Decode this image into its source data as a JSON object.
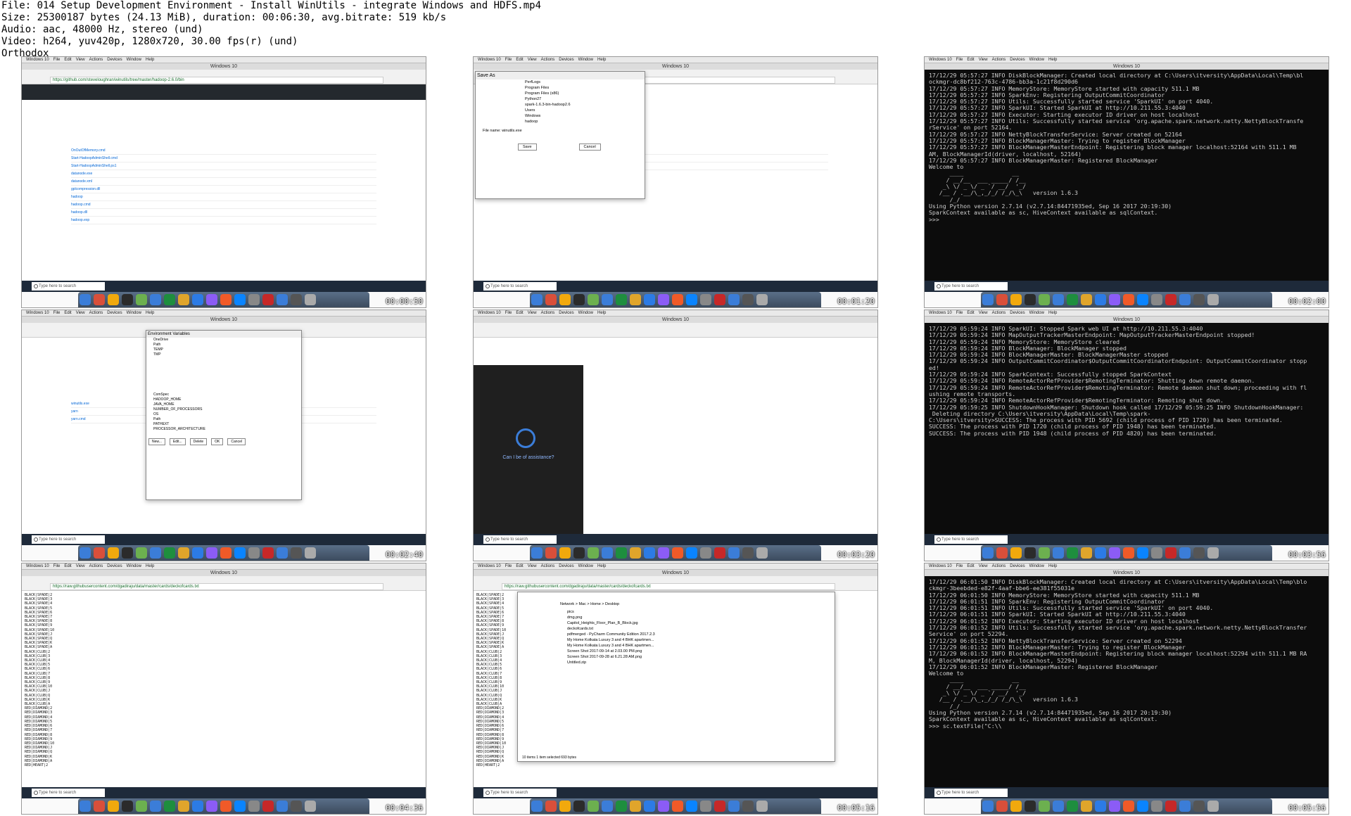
{
  "file_info": [
    "File: 014 Setup Development Environment - Install WinUtils - integrate Windows and HDFS.mp4",
    "Size: 25300187 bytes (24.13 MiB), duration: 00:06:30, avg.bitrate: 519 kb/s",
    "Audio: aac, 48000 Hz, stereo (und)",
    "Video: h264, yuv420p, 1280x720, 30.00 fps(r) (und)",
    "Orthodox"
  ],
  "vm_window_title": "Windows 10",
  "mac_menu": [
    "Windows 10",
    "File",
    "Edit",
    "View",
    "Actions",
    "Devices",
    "Window",
    "Help"
  ],
  "taskbar_search": "Type here to search",
  "thumbnails": [
    {
      "timestamp": "00:00:50",
      "kind": "github",
      "url": "https://github.com/steveloughran/winutils/tree/master/hadoop-2.6.0/bin",
      "files": [
        "OnOutOfMemory.cmd",
        "Start-HadoopAdminShell.cmd",
        "Start-HadoopAdminShell.ps1",
        "datanode.exe",
        "datanode.xml",
        "gplcompression.dll",
        "hadoop",
        "hadoop.cmd",
        "hadoop.dll",
        "hadoop.exp"
      ]
    },
    {
      "timestamp": "00:01:20",
      "kind": "saveas",
      "url": "https://github.com/steveloughran/winutils/tree/master/hadoop-2.6.0/bin",
      "dialog_title": "Save As",
      "folders": [
        "PerfLogs",
        "Program Files",
        "Program Files (x86)",
        "Python27",
        "spark-1.6.3-bin-hadoop2.6",
        "Users",
        "Windows",
        "hadoop"
      ],
      "file_name": "winutils.exe",
      "buttons": [
        "Save",
        "Cancel"
      ]
    },
    {
      "timestamp": "00:02:00",
      "kind": "terminal",
      "lines": [
        "17/12/29 05:57:27 INFO DiskBlockManager: Created local directory at C:\\Users\\itversity\\AppData\\Local\\Temp\\bl",
        "ockmgr-dc8bf212-763c-4786-bb3a-1c21f8d290d6",
        "17/12/29 05:57:27 INFO MemoryStore: MemoryStore started with capacity 511.1 MB",
        "17/12/29 05:57:27 INFO SparkEnv: Registering OutputCommitCoordinator",
        "17/12/29 05:57:27 INFO Utils: Successfully started service 'SparkUI' on port 4040.",
        "17/12/29 05:57:27 INFO SparkUI: Started SparkUI at http://10.211.55.3:4040",
        "17/12/29 05:57:27 INFO Executor: Starting executor ID driver on host localhost",
        "17/12/29 05:57:27 INFO Utils: Successfully started service 'org.apache.spark.network.netty.NettyBlockTransfe",
        "rService' on port 52164.",
        "17/12/29 05:57:27 INFO NettyBlockTransferService: Server created on 52164",
        "17/12/29 05:57:27 INFO BlockManagerMaster: Trying to register BlockManager",
        "17/12/29 05:57:27 INFO BlockManagerMasterEndpoint: Registering block manager localhost:52164 with 511.1 MB",
        "AM, BlockManagerId(driver, localhost, 52164)",
        "17/12/29 05:57:27 INFO BlockManagerMaster: Registered BlockManager",
        "Welcome to",
        "      ____              __",
        "     / __/__  ___ _____/ /__",
        "    _\\ \\/ _ \\/ _ `/ __/  '_/",
        "   /__ / .__/\\_,_/_/ /_/\\_\\   version 1.6.3",
        "      /_/",
        "",
        "Using Python version 2.7.14 (v2.7.14:84471935ed, Sep 16 2017 20:19:30)",
        "SparkContext available as sc, HiveContext available as sqlContext.",
        ">>>"
      ]
    },
    {
      "timestamp": "00:02:40",
      "kind": "envvars",
      "dialog_title": "Environment Variables",
      "user_vars": [
        "OneDrive",
        "Path",
        "TEMP",
        "TMP"
      ],
      "system_vars": [
        "ComSpec",
        "HADOOP_HOME",
        "JAVA_HOME",
        "NUMBER_OF_PROCESSORS",
        "OS",
        "Path",
        "PATHEXT",
        "PROCESSOR_ARCHITECTURE"
      ],
      "buttons": [
        "New...",
        "Edit...",
        "Delete",
        "OK",
        "Cancel"
      ]
    },
    {
      "timestamp": "00:03:20",
      "kind": "cortana",
      "prompt": "Can I be of assistance?"
    },
    {
      "timestamp": "00:03:56",
      "kind": "terminal",
      "lines": [
        "17/12/29 05:59:24 INFO SparkUI: Stopped Spark web UI at http://10.211.55.3:4040",
        "17/12/29 05:59:24 INFO MapOutputTrackerMasterEndpoint: MapOutputTrackerMasterEndpoint stopped!",
        "17/12/29 05:59:24 INFO MemoryStore: MemoryStore cleared",
        "17/12/29 05:59:24 INFO BlockManager: BlockManager stopped",
        "17/12/29 05:59:24 INFO BlockManagerMaster: BlockManagerMaster stopped",
        "17/12/29 05:59:24 INFO OutputCommitCoordinator$OutputCommitCoordinatorEndpoint: OutputCommitCoordinator stopp",
        "ed!",
        "17/12/29 05:59:24 INFO SparkContext: Successfully stopped SparkContext",
        "17/12/29 05:59:24 INFO RemoteActorRefProvider$RemotingTerminator: Shutting down remote daemon.",
        "17/12/29 05:59:24 INFO RemoteActorRefProvider$RemotingTerminator: Remote daemon shut down; proceeding with fl",
        "ushing remote transports.",
        "17/12/29 05:59:24 INFO RemoteActorRefProvider$RemotingTerminator: Remoting shut down.",
        "17/12/29 05:59:25 INFO ShutdownHookManager: Shutdown hook called 17/12/29 05:59:25 INFO ShutdownHookManager:",
        " Deleting directory C:\\Users\\itversity\\AppData\\Local\\Temp\\spark-",
        "",
        "C:\\Users\\itversity>SUCCESS: The process with PID 5692 (child process of PID 1720) has been terminated.",
        "SUCCESS: The process with PID 1720 (child process of PID 1948) has been terminated.",
        "SUCCESS: The process with PID 1948 (child process of PID 4820) has been terminated."
      ]
    },
    {
      "timestamp": "00:04:36",
      "kind": "plaintext",
      "url": "https://raw.githubusercontent.com/dgadiraju/data/master/cards/deckofcards.txt",
      "lines": [
        "BLACK|SPADE|2",
        "BLACK|SPADE|3",
        "BLACK|SPADE|4",
        "BLACK|SPADE|5",
        "BLACK|SPADE|6",
        "BLACK|SPADE|7",
        "BLACK|SPADE|8",
        "BLACK|SPADE|9",
        "BLACK|SPADE|10",
        "BLACK|SPADE|J",
        "BLACK|SPADE|Q",
        "BLACK|SPADE|K",
        "BLACK|SPADE|A",
        "BLACK|CLUB|2",
        "BLACK|CLUB|3",
        "BLACK|CLUB|4",
        "BLACK|CLUB|5",
        "BLACK|CLUB|6",
        "BLACK|CLUB|7",
        "BLACK|CLUB|8",
        "BLACK|CLUB|9",
        "BLACK|CLUB|10",
        "BLACK|CLUB|J",
        "BLACK|CLUB|Q",
        "BLACK|CLUB|K",
        "BLACK|CLUB|A",
        "RED|DIAMOND|2",
        "RED|DIAMOND|3",
        "RED|DIAMOND|4",
        "RED|DIAMOND|5",
        "RED|DIAMOND|6",
        "RED|DIAMOND|7",
        "RED|DIAMOND|8",
        "RED|DIAMOND|9",
        "RED|DIAMOND|10",
        "RED|DIAMOND|J",
        "RED|DIAMOND|Q",
        "RED|DIAMOND|K",
        "RED|DIAMOND|A",
        "RED|HEART|2"
      ]
    },
    {
      "timestamp": "00:05:16",
      "kind": "explorer",
      "url": "https://raw.githubusercontent.com/dgadiraju/data/master/cards/deckofcards.txt",
      "path": "Network > Mac > Home > Desktop",
      "files": [
        "pics",
        "dmg.png",
        "Capitol_Heights_Floor_Plan_B_Block.jpg",
        "deckofcards.txt",
        "pdfmerged - PyCharm Community Edition 2017.2.3",
        "My Home Kolkata Luxury 3 and 4 BHK apartmen...",
        "My Home Kolkata Luxury 3 and 4 BHK apartmen...",
        "Screen Shot 2017-09-14 at 2.03.00 PM.png",
        "Screen Shot 2017-09-28 at 6.21.28 AM.png",
        "Untitled.zip"
      ],
      "status": "10 items   1 item selected  693 bytes"
    },
    {
      "timestamp": "00:05:56",
      "kind": "terminal",
      "lines": [
        "17/12/29 06:01:50 INFO DiskBlockManager: Created local directory at C:\\Users\\itversity\\AppData\\Local\\Temp\\blo",
        "ckmgr-3beebded-e82f-4aaf-bbe6-ee381f55031e",
        "17/12/29 06:01:50 INFO MemoryStore: MemoryStore started with capacity 511.1 MB",
        "17/12/29 06:01:51 INFO SparkEnv: Registering OutputCommitCoordinator",
        "17/12/29 06:01:51 INFO Utils: Successfully started service 'SparkUI' on port 4040.",
        "17/12/29 06:01:51 INFO SparkUI: Started SparkUI at http://10.211.55.3:4040",
        "17/12/29 06:01:52 INFO Executor: Starting executor ID driver on host localhost",
        "17/12/29 06:01:52 INFO Utils: Successfully started service 'org.apache.spark.network.netty.NettyBlockTransfer",
        "Service' on port 52294.",
        "17/12/29 06:01:52 INFO NettyBlockTransferService: Server created on 52294",
        "17/12/29 06:01:52 INFO BlockManagerMaster: Trying to register BlockManager",
        "17/12/29 06:01:52 INFO BlockManagerMasterEndpoint: Registering block manager localhost:52294 with 511.1 MB RA",
        "M, BlockManagerId(driver, localhost, 52294)",
        "17/12/29 06:01:52 INFO BlockManagerMaster: Registered BlockManager",
        "Welcome to",
        "      ____              __",
        "     / __/__  ___ _____/ /__",
        "    _\\ \\/ _ \\/ _ `/ __/  '_/",
        "   /__ / .__/\\_,_/_/ /_/\\_\\   version 1.6.3",
        "      /_/",
        "",
        "Using Python version 2.7.14 (v2.7.14:84471935ed, Sep 16 2017 20:19:30)",
        "SparkContext available as sc, HiveContext available as sqlContext.",
        ">>> sc.textFile(\"C:\\\\"
      ]
    }
  ]
}
